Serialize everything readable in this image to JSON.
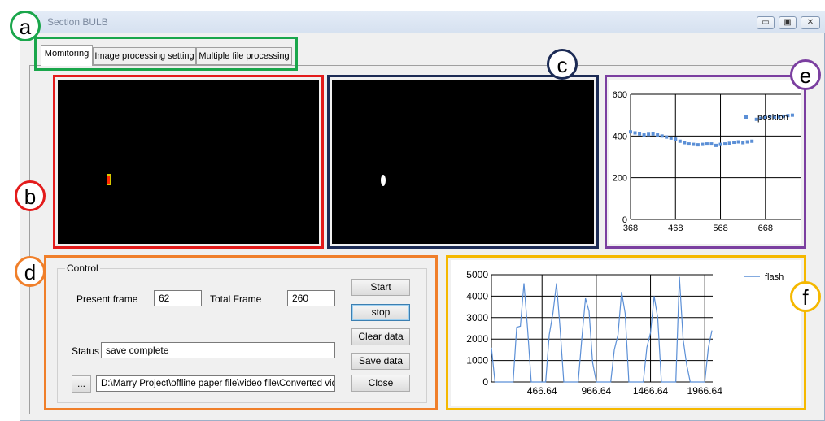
{
  "window": {
    "title": "Section BULB",
    "controls": [
      "▭",
      "▣",
      "✕"
    ]
  },
  "tabs": [
    {
      "label": "Momitoring"
    },
    {
      "label": "Image processing setting"
    },
    {
      "label": "Multiple file processing"
    }
  ],
  "callouts": {
    "a": "a",
    "b": "b",
    "c": "c",
    "d": "d",
    "e": "e",
    "f": "f"
  },
  "colors": {
    "a": "#1aa64b",
    "b": "#e31b1b",
    "c": "#1c2b55",
    "d": "#f07f2a",
    "e": "#7b3fa0",
    "f": "#f5b800",
    "series": "#5b8fd6"
  },
  "control": {
    "group_label": "Control",
    "present_frame_label": "Present frame",
    "present_frame_value": "62",
    "total_frame_label": "Total Frame",
    "total_frame_value": "260",
    "status_label": "Status",
    "status_value": "save complete",
    "browse_label": "...",
    "path_value": "D:\\Marry Project\\offline paper file\\video file\\Converted video\\",
    "buttons": {
      "start": "Start",
      "stop": "stop",
      "clear": "Clear data",
      "save": "Save data",
      "close": "Close"
    }
  },
  "chart_data": [
    {
      "type": "scatter",
      "series": [
        {
          "name": "position",
          "x": [
            368,
            378,
            388,
            398,
            408,
            418,
            428,
            438,
            448,
            458,
            468,
            478,
            488,
            498,
            508,
            518,
            528,
            538,
            548,
            558,
            568,
            578,
            588,
            598,
            608,
            618,
            628,
            638,
            648,
            658,
            668,
            678,
            688,
            698,
            708,
            718,
            728
          ],
          "y": [
            420,
            415,
            410,
            405,
            408,
            410,
            405,
            400,
            395,
            390,
            385,
            375,
            368,
            362,
            360,
            358,
            360,
            362,
            362,
            355,
            360,
            362,
            365,
            370,
            372,
            368,
            372,
            375,
            480,
            485,
            490,
            495,
            490,
            492,
            495,
            498,
            500
          ]
        }
      ],
      "xticks": [
        "368",
        "468",
        "568",
        "668"
      ],
      "yticks": [
        "0",
        "200",
        "400",
        "600"
      ],
      "xlim": [
        368,
        748
      ],
      "ylim": [
        0,
        600
      ],
      "grid": true,
      "legend": "top-right"
    },
    {
      "type": "line",
      "series": [
        {
          "name": "flash",
          "x": [
            0,
            33,
            67,
            100,
            133,
            167,
            200,
            233,
            267,
            300,
            333,
            367,
            400,
            433,
            467,
            500,
            533,
            567,
            600,
            633,
            667,
            700,
            733,
            767,
            800,
            833,
            867,
            900,
            933,
            967,
            1000,
            1033,
            1067,
            1100,
            1133,
            1167,
            1200,
            1233,
            1267,
            1300,
            1333,
            1367,
            1400,
            1433,
            1467,
            1500,
            1533,
            1567,
            1600,
            1633,
            1667,
            1700,
            1733,
            1767,
            1800,
            1833,
            1867,
            1900,
            1933,
            1967,
            2000,
            2033
          ],
          "y": [
            1600,
            0,
            0,
            0,
            0,
            0,
            0,
            2550,
            2600,
            4600,
            2500,
            0,
            0,
            0,
            0,
            0,
            2200,
            3200,
            4600,
            2500,
            0,
            0,
            0,
            0,
            0,
            2000,
            3900,
            3300,
            900,
            0,
            0,
            0,
            0,
            0,
            1500,
            2200,
            4200,
            3200,
            0,
            0,
            0,
            0,
            0,
            1600,
            2300,
            4000,
            3000,
            0,
            0,
            0,
            0,
            0,
            4900,
            2000,
            800,
            0,
            0,
            0,
            0,
            0,
            1600,
            2400
          ]
        }
      ],
      "xticks": [
        "466.64",
        "966.64",
        "1466.64",
        "1966.64"
      ],
      "yticks": [
        "0",
        "1000",
        "2000",
        "3000",
        "4000",
        "5000"
      ],
      "xlim": [
        0,
        2040
      ],
      "ylim": [
        0,
        5000
      ],
      "grid": true,
      "legend": "top-right"
    }
  ]
}
